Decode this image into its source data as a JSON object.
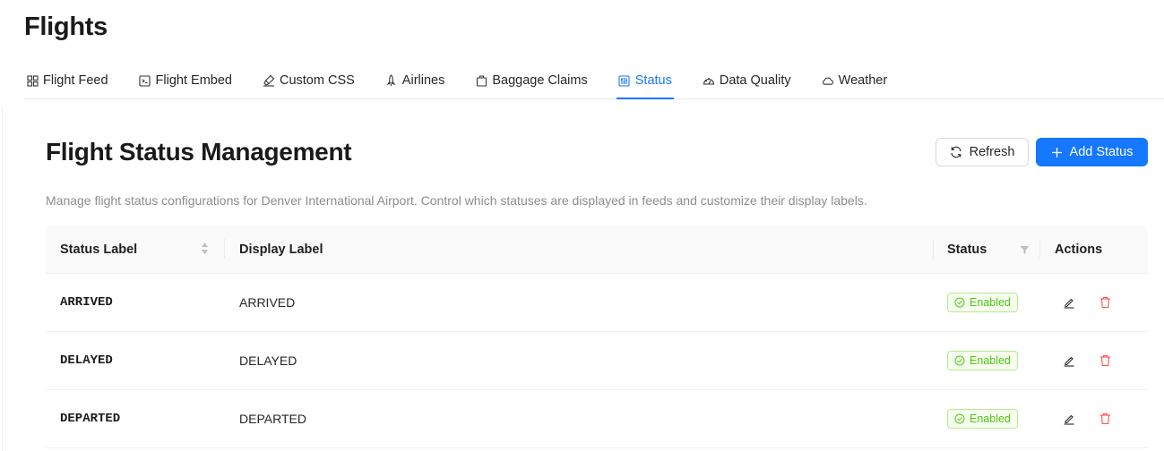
{
  "header": {
    "title": "Flights"
  },
  "tabs": [
    {
      "label": "Flight Feed",
      "icon": "grid-icon"
    },
    {
      "label": "Flight Embed",
      "icon": "code-icon"
    },
    {
      "label": "Custom CSS",
      "icon": "brush-icon"
    },
    {
      "label": "Airlines",
      "icon": "rocket-icon"
    },
    {
      "label": "Baggage Claims",
      "icon": "bag-icon"
    },
    {
      "label": "Status",
      "icon": "sliders-icon",
      "active": true
    },
    {
      "label": "Data Quality",
      "icon": "dashboard-icon"
    },
    {
      "label": "Weather",
      "icon": "cloud-icon"
    }
  ],
  "card": {
    "title": "Flight Status Management",
    "refresh_label": "Refresh",
    "add_label": "Add Status",
    "description": "Manage flight status configurations for Denver International Airport. Control which statuses are displayed in feeds and customize their display labels."
  },
  "table": {
    "columns": [
      "Status Label",
      "Display Label",
      "Status",
      "Actions"
    ],
    "rows": [
      {
        "status_label": "ARRIVED",
        "display_label": "ARRIVED",
        "status": "Enabled"
      },
      {
        "status_label": "DELAYED",
        "display_label": "DELAYED",
        "status": "Enabled"
      },
      {
        "status_label": "DEPARTED",
        "display_label": "DEPARTED",
        "status": "Enabled"
      }
    ]
  },
  "colors": {
    "accent": "#1677ff",
    "enabled_text": "#52c41a",
    "enabled_border": "#b7eb8f",
    "enabled_bg": "#f6ffed",
    "delete": "#ff4d4f"
  }
}
